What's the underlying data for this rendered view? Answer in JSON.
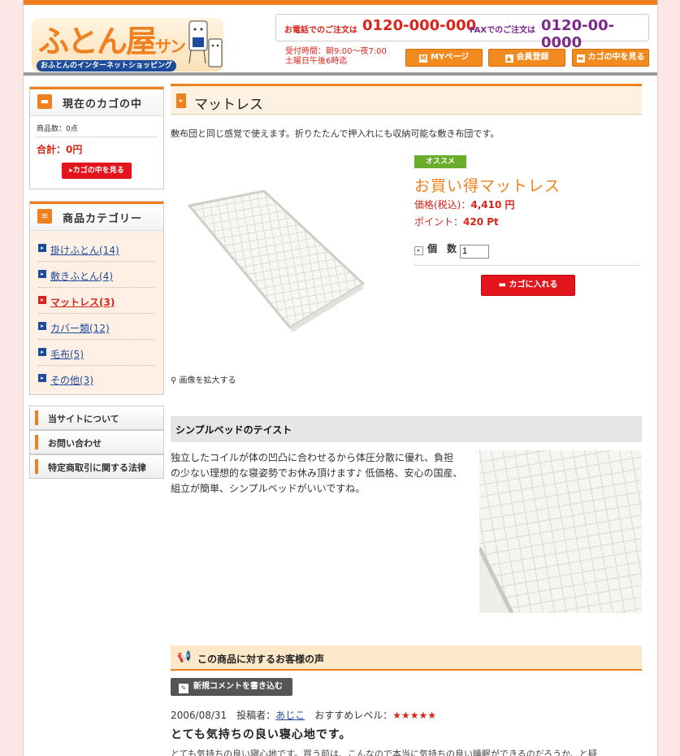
{
  "header": {
    "logo_title": "ふとん屋",
    "logo_title_small": "サン",
    "logo_tagline": "おふとんのインターネットショッピング",
    "phone_label": "お電話でのご注文は",
    "phone_number": "0120-000-000",
    "fax_label": "FAXでのご注文は",
    "fax_number": "0120-00-0000",
    "hours_line1": "受付時間：朝9:00～夜7:00",
    "hours_line2": "土曜日午後6時迄",
    "buttons": {
      "mypage": "MYページ",
      "member": "会員登録",
      "cart": "カゴの中を見る"
    }
  },
  "sidebar": {
    "cart": {
      "heading": "現在のカゴの中",
      "count": "商品数：0点",
      "total": "合計：0円",
      "view_button": "▸カゴの中を見る"
    },
    "categories": {
      "heading": "商品カテゴリー",
      "items": [
        {
          "label": "掛けふとん(14)",
          "active": false
        },
        {
          "label": "敷きふとん(4)",
          "active": false
        },
        {
          "label": "マットレス(3)",
          "active": true
        },
        {
          "label": "カバー類(12)",
          "active": false
        },
        {
          "label": "毛布(5)",
          "active": false
        },
        {
          "label": "その他(3)",
          "active": false
        }
      ]
    },
    "nav": {
      "about": "当サイトについて",
      "contact": "お問い合わせ",
      "law": "特定商取引に関する法律"
    }
  },
  "product": {
    "page_title": "マットレス",
    "description": "敷布団と同じ感覚で使えます。折りたたんで押入れにも収納可能な敷き布団です。",
    "zoom_label": "画像を拡大する",
    "badge": "オススメ",
    "name": "お買い得マットレス",
    "price_label": "価格(税込)：",
    "price_value": "4,410 円",
    "points_label": "ポイント：",
    "points_value": "420 Pt",
    "quantity_label": "個　数",
    "quantity_value": "1",
    "add_to_cart": "カゴに入れる"
  },
  "section": {
    "title": "シンプルベッドのテイスト",
    "body": "独立したコイルが体の凹凸に合わせるから体圧分散に優れ、負担の少ない理想的な寝姿勢でお休み頂けます♪ 低価格、安心の国産、組立が簡単、シンプルベッドがいいですね。"
  },
  "reviews": {
    "heading": "この商品に対するお客様の声",
    "write_button": "新規コメントを書き込む",
    "items": [
      {
        "date": "2006/08/31",
        "poster_label": "投稿者：",
        "poster": "あじこ",
        "level_label": "おすすめレベル：",
        "stars": "★★★★★",
        "title": "とても気持ちの良い寝心地です。",
        "body": "とても気持ちの良い寝心地です。買う前は、こんなので本当に気持ちの良い睡眠ができるのだろうか、と疑"
      }
    ]
  },
  "colors": {
    "accent": "#f07f1f",
    "red": "#d9241b",
    "link": "#1d4c9a",
    "page_bg": "#fde6e6"
  }
}
